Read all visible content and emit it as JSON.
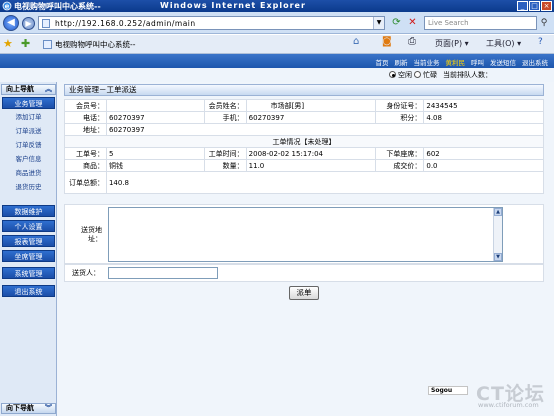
{
  "window": {
    "title": "电视购物呼叫中心系统--",
    "browser_title": "Windows Internet Explorer"
  },
  "addressbar": {
    "url": "http://192.168.0.252/admin/main",
    "search_placeholder": "Live Search"
  },
  "commandbar": {
    "tab_title": "电视购物呼叫中心系统--",
    "page_label": "页面(P)",
    "tools_label": "工具(O)"
  },
  "toplinks": [
    {
      "label": "首页",
      "hot": false
    },
    {
      "label": "刷新",
      "hot": false
    },
    {
      "label": "当前业务",
      "hot": false
    },
    {
      "label": "黄利民",
      "hot": true
    },
    {
      "label": "呼叫",
      "hot": false
    },
    {
      "label": "发送短信",
      "hot": false
    },
    {
      "label": "退出系统",
      "hot": false
    }
  ],
  "status": {
    "radio_idle": "空闲",
    "radio_busy": "忙碌",
    "queue_label": "当前排队人数：",
    "selected": "idle"
  },
  "sidebar": {
    "header": "向上导航",
    "footer": "向下导航",
    "groups": [
      {
        "label": "业务管理",
        "items": [
          "添加订单",
          "订单派送",
          "订单反馈",
          "客户信息",
          "商品进货",
          "退货历史"
        ]
      },
      {
        "label": "数据维护",
        "items": []
      },
      {
        "label": "个人设置",
        "items": []
      },
      {
        "label": "报表管理",
        "items": []
      },
      {
        "label": "坐席管理",
        "items": []
      },
      {
        "label": "系统管理",
        "items": []
      },
      {
        "label": "退出系统",
        "items": []
      }
    ]
  },
  "panel": {
    "title": "业务管理－工单派送",
    "member_no_label": "会员号：",
    "member_no": "",
    "member_name_label": "会员姓名：",
    "member_name": "市场部[男]",
    "id_label": "身份证号：",
    "id_no": "2434545",
    "phone_label": "电话：",
    "phone": "60270397",
    "mobile_label": "手机：",
    "mobile": "60270397",
    "points_label": "积分：",
    "points": "4.08",
    "address_label": "地址：",
    "address": "60270397",
    "section_title": "工单情况【未处理】",
    "order_no_label": "工单号：",
    "order_no": "5",
    "order_time_label": "工单时间：",
    "order_time": "2008-02-02 15:17:04",
    "agent_label": "下单座席：",
    "agent": "602",
    "product_label": "商品：",
    "product": "铜钱",
    "qty_label": "数量：",
    "qty": "11.0",
    "deal_price_label": "成交价：",
    "deal_price": "0.0",
    "total_label": "订单总额：",
    "total": "140.8",
    "delivery_addr_label": "送货地址：",
    "deliverer_label": "送货人：",
    "dispatch_button": "派单"
  },
  "watermark": {
    "sogou": "Sogou",
    "site_big": "CT论坛",
    "site_small": "www.ctiforum.com"
  }
}
